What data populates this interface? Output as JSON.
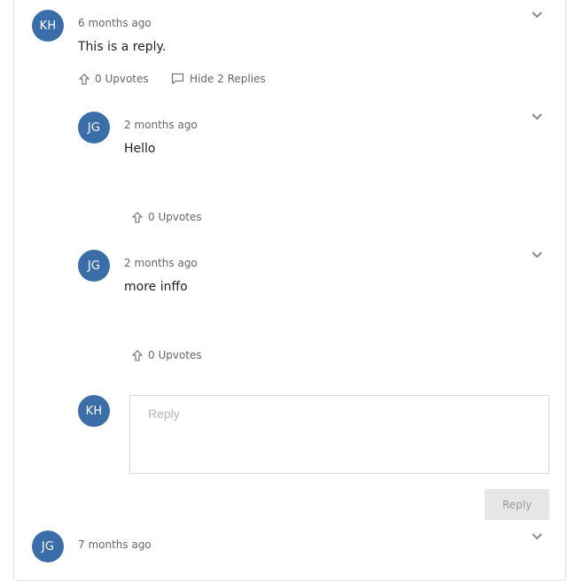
{
  "colors": {
    "avatar_bg": "#3b6ea8",
    "meta_text": "#666666",
    "border": "#e2e2e2",
    "reply_button_bg": "#e6e6e6"
  },
  "comments": [
    {
      "initials": "KH",
      "time": "6 months ago",
      "text": "This is a reply.",
      "upvotes": "0 Upvotes",
      "toggle_replies": "Hide 2 Replies",
      "icons": [
        "upvote-arrow-icon",
        "speech-bubble-icon",
        "chevron-down-icon"
      ]
    },
    {
      "initials": "JG",
      "time": "2 months ago",
      "text": "Hello",
      "upvotes": "0 Upvotes"
    },
    {
      "initials": "JG",
      "time": "2 months ago",
      "text": "more inffo",
      "upvotes": "0 Upvotes"
    },
    {
      "initials": "JG",
      "time": "7 months ago"
    }
  ],
  "reply_form": {
    "initials": "KH",
    "placeholder": "Reply",
    "value": "",
    "button_label": "Reply"
  }
}
